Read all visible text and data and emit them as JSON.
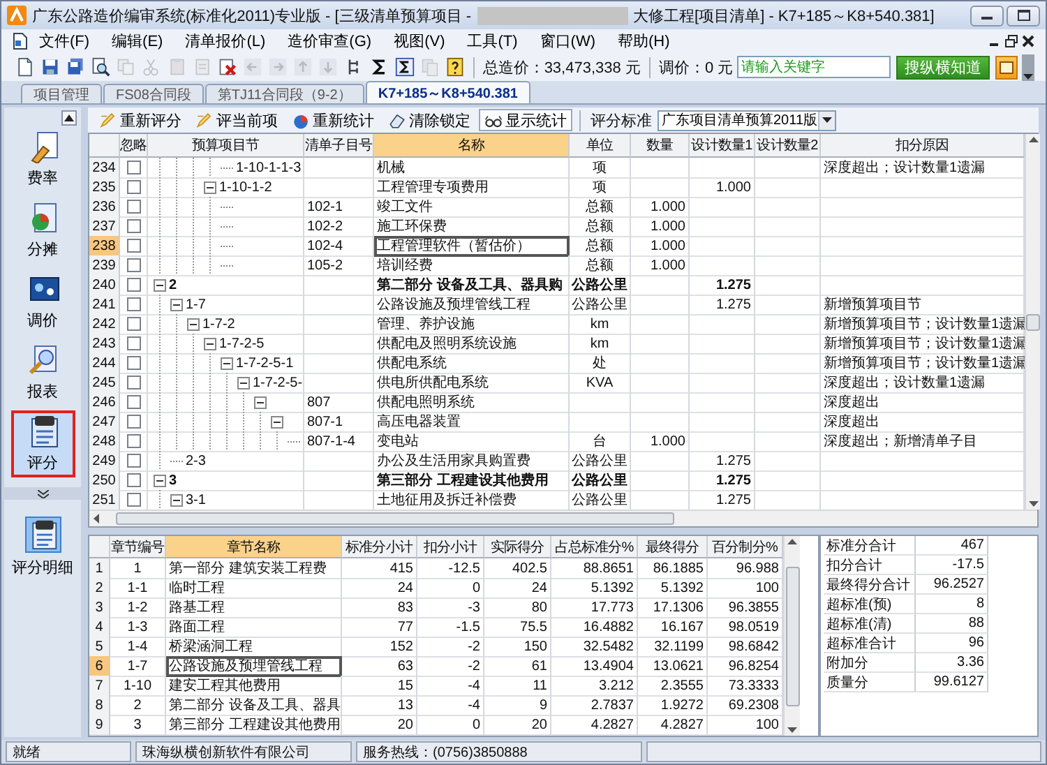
{
  "window": {
    "title_prefix": "广东公路造价编审系统(标准化2011)专业版 - [三级清单预算项目 -",
    "title_suffix": "大修工程[项目清单] - K7+185～K8+540.381]"
  },
  "menu": [
    "文件(F)",
    "编辑(E)",
    "清单报价(L)",
    "造价审查(G)",
    "视图(V)",
    "工具(T)",
    "窗口(W)",
    "帮助(H)"
  ],
  "toolbar": {
    "buttons": [
      {
        "kind": "new",
        "disabled": false
      },
      {
        "kind": "save",
        "disabled": false
      },
      {
        "kind": "save-all",
        "disabled": false
      },
      {
        "kind": "preview",
        "disabled": false
      },
      {
        "kind": "copy",
        "disabled": true
      },
      {
        "kind": "cut",
        "disabled": true
      },
      {
        "kind": "paste",
        "disabled": true
      },
      {
        "kind": "insert",
        "disabled": true
      },
      {
        "kind": "delete",
        "disabled": false
      },
      {
        "kind": "left",
        "disabled": true
      },
      {
        "kind": "right",
        "disabled": true
      },
      {
        "kind": "up",
        "disabled": true
      },
      {
        "kind": "down",
        "disabled": true
      },
      {
        "kind": "tree",
        "disabled": false
      },
      {
        "kind": "sum",
        "disabled": false
      },
      {
        "kind": "sum-box",
        "disabled": false
      },
      {
        "kind": "pages",
        "disabled": true
      },
      {
        "kind": "help",
        "disabled": false
      }
    ],
    "total_label": "总造价：33,473,338 元",
    "adjust_label": "调价：0 元",
    "search": {
      "placeholder": "请输入关键字"
    },
    "search_button": "搜纵横知道"
  },
  "tabs": [
    {
      "label": "项目管理",
      "selected": false
    },
    {
      "label": "FS08合同段",
      "selected": false
    },
    {
      "label": "第TJ11合同段（9-2）",
      "selected": false
    },
    {
      "label": "K7+185～K8+540.381",
      "selected": true
    }
  ],
  "sidebar": {
    "items": [
      {
        "label": "费率",
        "kind": "rate",
        "selected": false
      },
      {
        "label": "分摊",
        "kind": "share",
        "selected": false
      },
      {
        "label": "调价",
        "kind": "adjust",
        "selected": false
      },
      {
        "label": "报表",
        "kind": "report",
        "selected": false
      },
      {
        "label": "评分",
        "kind": "score",
        "selected": true
      }
    ],
    "detail_items": [
      {
        "label": "评分明细",
        "kind": "detail",
        "selected": true
      }
    ]
  },
  "score_toolbar": {
    "buttons": [
      {
        "label": "重新评分",
        "kind": "rescore",
        "pressed": false
      },
      {
        "label": "评当前项",
        "kind": "score-current",
        "pressed": false
      },
      {
        "label": "重新统计",
        "kind": "restat",
        "pressed": false
      },
      {
        "label": "清除锁定",
        "kind": "unlock",
        "pressed": false
      },
      {
        "label": "显示统计",
        "kind": "show-stats",
        "pressed": true
      }
    ],
    "standard_label": "评分标准",
    "standard_value": "广东项目清单预算2011版"
  },
  "upper_table": {
    "columns": [
      {
        "label": "忽略",
        "selected": false
      },
      {
        "label": "预算项目节",
        "selected": false
      },
      {
        "label": "清单子目号",
        "selected": false
      },
      {
        "label": "名称",
        "selected": true
      },
      {
        "label": "单位",
        "selected": false
      },
      {
        "label": "数量",
        "selected": false
      },
      {
        "label": "设计数量1",
        "selected": false
      },
      {
        "label": "设计数量2",
        "selected": false
      },
      {
        "label": "扣分原因",
        "selected": false
      }
    ],
    "rows": [
      {
        "continued": true,
        "children": [
          {
            "continued": true,
            "children": [
              {
                "continued": true,
                "children": [
                  {
                    "continued": true,
                    "children": [
                      {
                        "no": "234",
                        "ignored": false,
                        "selected": false,
                        "kind": "item",
                        "code": "1-10-1-1-3",
                        "name": "机械",
                        "unit": "项",
                        "reason": "深度超出；设计数量1遗漏"
                      }
                    ]
                  },
                  {
                    "no": "235",
                    "ignored": false,
                    "selected": false,
                    "kind": "item",
                    "expanded": true,
                    "code": "1-10-1-2",
                    "name": "工程管理专项费用",
                    "unit": "项",
                    "design_qty1": "1.000",
                    "children": [
                      {
                        "no": "236",
                        "ignored": false,
                        "selected": false,
                        "kind": "item",
                        "item_no": "102-1",
                        "name": "竣工文件",
                        "unit": "总额",
                        "qty": "1.000"
                      },
                      {
                        "no": "237",
                        "ignored": false,
                        "selected": false,
                        "kind": "item",
                        "item_no": "102-2",
                        "name": "施工环保费",
                        "unit": "总额",
                        "qty": "1.000"
                      },
                      {
                        "no": "238",
                        "ignored": false,
                        "selected": true,
                        "kind": "item",
                        "item_no": "102-4",
                        "name": "工程管理软件（暂估价）",
                        "unit": "总额",
                        "qty": "1.000"
                      },
                      {
                        "no": "239",
                        "ignored": false,
                        "selected": false,
                        "kind": "item",
                        "item_no": "105-2",
                        "name": "培训经费",
                        "unit": "总额",
                        "qty": "1.000"
                      }
                    ]
                  }
                ]
              }
            ]
          }
        ]
      },
      {
        "no": "240",
        "ignored": false,
        "selected": false,
        "kind": "part",
        "expanded": true,
        "code": "2",
        "name": "第二部分 设备及工具、器具购",
        "unit": "公路公里",
        "design_qty1": "1.275",
        "children": [
          {
            "no": "241",
            "ignored": false,
            "selected": false,
            "kind": "item",
            "expanded": true,
            "code": "1-7",
            "name": "公路设施及预埋管线工程",
            "unit": "公路公里",
            "design_qty1": "1.275",
            "reason": "新增预算项目节",
            "children": [
              {
                "no": "242",
                "ignored": false,
                "selected": false,
                "kind": "item",
                "expanded": true,
                "code": "1-7-2",
                "name": "管理、养护设施",
                "unit": "km",
                "reason": "新增预算项目节；设计数量1遗漏",
                "children": [
                  {
                    "no": "243",
                    "ignored": false,
                    "selected": false,
                    "kind": "item",
                    "expanded": true,
                    "code": "1-7-2-5",
                    "name": "供配电及照明系统设施",
                    "unit": "km",
                    "reason": "新增预算项目节；设计数量1遗漏",
                    "children": [
                      {
                        "no": "244",
                        "ignored": false,
                        "selected": false,
                        "kind": "item",
                        "expanded": true,
                        "code": "1-7-2-5-1",
                        "name": "供配电系统",
                        "unit": "处",
                        "reason": "新增预算项目节；设计数量1遗漏",
                        "children": [
                          {
                            "no": "245",
                            "ignored": false,
                            "selected": false,
                            "kind": "item",
                            "expanded": true,
                            "code": "1-7-2-5-",
                            "name": "供电所供配电系统",
                            "unit": "KVA",
                            "reason": "深度超出；设计数量1遗漏",
                            "children": [
                              {
                                "no": "246",
                                "ignored": false,
                                "selected": false,
                                "kind": "item",
                                "expanded": true,
                                "item_no": "807",
                                "name": "供配电照明系统",
                                "reason": "深度超出",
                                "children": [
                                  {
                                    "no": "247",
                                    "ignored": false,
                                    "selected": false,
                                    "kind": "item",
                                    "expanded": true,
                                    "item_no": "807-1",
                                    "name": "高压电器装置",
                                    "reason": "深度超出",
                                    "children": [
                                      {
                                        "no": "248",
                                        "ignored": false,
                                        "selected": false,
                                        "kind": "item",
                                        "item_no": "807-1-4",
                                        "name": "变电站",
                                        "unit": "台",
                                        "qty": "1.000",
                                        "reason": "深度超出；新增清单子目"
                                      }
                                    ]
                                  }
                                ]
                              }
                            ]
                          }
                        ]
                      }
                    ]
                  }
                ]
              }
            ]
          },
          {
            "no": "249",
            "ignored": false,
            "selected": false,
            "kind": "item",
            "code": "2-3",
            "name": "办公及生活用家具购置费",
            "unit": "公路公里",
            "design_qty1": "1.275"
          }
        ]
      },
      {
        "no": "250",
        "ignored": false,
        "selected": false,
        "kind": "part",
        "expanded": true,
        "code": "3",
        "name": "第三部分 工程建设其他费用",
        "unit": "公路公里",
        "design_qty1": "1.275",
        "children": [
          {
            "no": "251",
            "ignored": false,
            "selected": false,
            "kind": "item",
            "expanded": true,
            "code": "3-1",
            "name": "土地征用及拆迁补偿费",
            "unit": "公路公里",
            "design_qty1": "1.275"
          }
        ]
      }
    ]
  },
  "lower_table": {
    "columns": [
      {
        "label": "章节编号",
        "selected": false
      },
      {
        "label": "章节名称",
        "selected": true
      },
      {
        "label": "标准分小计",
        "selected": false
      },
      {
        "label": "扣分小计",
        "selected": false
      },
      {
        "label": "实际得分",
        "selected": false
      },
      {
        "label": "占总标准分%",
        "selected": false
      },
      {
        "label": "最终得分",
        "selected": false
      },
      {
        "label": "百分制分%",
        "selected": false
      }
    ],
    "rows": [
      {
        "no": "1",
        "code": "1",
        "name": "第一部分 建筑安装工程费",
        "std": "415",
        "deduct": "-12.5",
        "actual": "402.5",
        "pct_total": "88.8651",
        "final": "86.1885",
        "pct100": "96.988",
        "selected": false
      },
      {
        "no": "2",
        "code": "1-1",
        "name": "临时工程",
        "std": "24",
        "deduct": "0",
        "actual": "24",
        "pct_total": "5.1392",
        "final": "5.1392",
        "pct100": "100",
        "selected": false
      },
      {
        "no": "3",
        "code": "1-2",
        "name": "路基工程",
        "std": "83",
        "deduct": "-3",
        "actual": "80",
        "pct_total": "17.773",
        "final": "17.1306",
        "pct100": "96.3855",
        "selected": false
      },
      {
        "no": "4",
        "code": "1-3",
        "name": "路面工程",
        "std": "77",
        "deduct": "-1.5",
        "actual": "75.5",
        "pct_total": "16.4882",
        "final": "16.167",
        "pct100": "98.0519",
        "selected": false
      },
      {
        "no": "5",
        "code": "1-4",
        "name": "桥梁涵洞工程",
        "std": "152",
        "deduct": "-2",
        "actual": "150",
        "pct_total": "32.5482",
        "final": "32.1199",
        "pct100": "98.6842",
        "selected": false
      },
      {
        "no": "6",
        "code": "1-7",
        "name": "公路设施及预埋管线工程",
        "std": "63",
        "deduct": "-2",
        "actual": "61",
        "pct_total": "13.4904",
        "final": "13.0621",
        "pct100": "96.8254",
        "selected": true
      },
      {
        "no": "7",
        "code": "1-10",
        "name": "建安工程其他费用",
        "std": "15",
        "deduct": "-4",
        "actual": "11",
        "pct_total": "3.212",
        "final": "2.3555",
        "pct100": "73.3333",
        "selected": false
      },
      {
        "no": "8",
        "code": "2",
        "name": "第二部分 设备及工具、器具",
        "std": "13",
        "deduct": "-4",
        "actual": "9",
        "pct_total": "2.7837",
        "final": "1.9272",
        "pct100": "69.2308",
        "selected": false
      },
      {
        "no": "9",
        "code": "3",
        "name": "第三部分 工程建设其他费用",
        "std": "20",
        "deduct": "0",
        "actual": "20",
        "pct_total": "4.2827",
        "final": "4.2827",
        "pct100": "100",
        "selected": false
      }
    ]
  },
  "summary": [
    {
      "label": "标准分合计",
      "value": "467"
    },
    {
      "label": "扣分合计",
      "value": "-17.5"
    },
    {
      "label": "最终得分合计",
      "value": "96.2527"
    },
    {
      "label": "超标准(预)",
      "value": "8"
    },
    {
      "label": "超标准(清)",
      "value": "88"
    },
    {
      "label": "超标准合计",
      "value": "96"
    },
    {
      "label": "附加分",
      "value": "3.36"
    },
    {
      "label": "质量分",
      "value": "99.6127"
    }
  ],
  "status_bar": [
    "就绪",
    "珠海纵横创新软件有限公司",
    "服务热线：(0756)3850888"
  ]
}
